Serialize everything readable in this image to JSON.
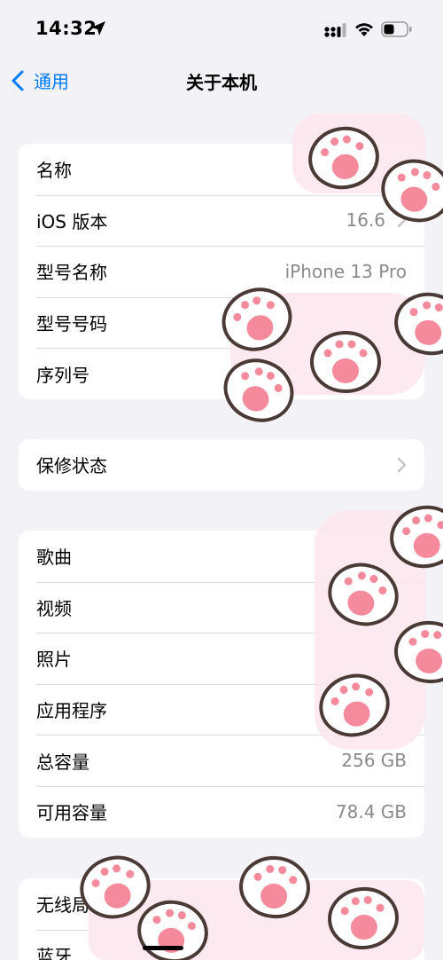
{
  "status_bar": {
    "time": "14:32"
  },
  "nav": {
    "back_label": "通用",
    "title": "关于本机"
  },
  "group1": {
    "rows": [
      {
        "label": "名称",
        "value": ""
      },
      {
        "label": "iOS 版本",
        "value": "16.6"
      },
      {
        "label": "型号名称",
        "value": "iPhone 13 Pro"
      },
      {
        "label": "型号号码",
        "value": ""
      },
      {
        "label": "序列号",
        "value": ""
      }
    ]
  },
  "group2": {
    "rows": [
      {
        "label": "保修状态"
      }
    ]
  },
  "group3": {
    "rows": [
      {
        "label": "歌曲",
        "value": ""
      },
      {
        "label": "视频",
        "value": ""
      },
      {
        "label": "照片",
        "value": ""
      },
      {
        "label": "应用程序",
        "value": ""
      },
      {
        "label": "总容量",
        "value": "256 GB"
      },
      {
        "label": "可用容量",
        "value": "78.4 GB"
      }
    ]
  },
  "group4": {
    "rows": [
      {
        "label": "无线局"
      },
      {
        "label": "蓝牙"
      }
    ]
  },
  "colors": {
    "accent": "#007aff",
    "background": "#f2f2f7",
    "paw_pink": "#f48a9c",
    "paw_bg": "#fde8ee"
  }
}
